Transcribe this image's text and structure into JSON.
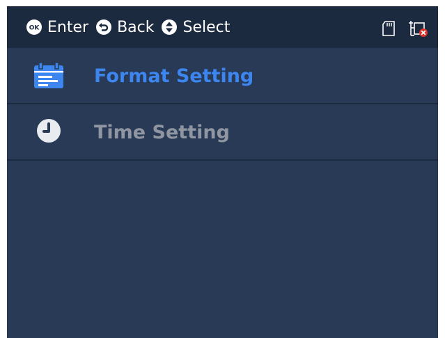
{
  "topbar": {
    "hints": [
      {
        "icon": "ok-button-icon",
        "label": "Enter"
      },
      {
        "icon": "back-button-icon",
        "label": "Back"
      },
      {
        "icon": "up-down-select-icon",
        "label": "Select"
      }
    ],
    "status_icons": [
      "sd-card-icon",
      "network-disconnected-icon"
    ]
  },
  "menu": {
    "items": [
      {
        "label": "Format Setting",
        "icon": "calendar-icon",
        "selected": true
      },
      {
        "label": "Time Setting",
        "icon": "clock-icon",
        "selected": false
      }
    ]
  },
  "colors": {
    "background": "#283a55",
    "topbar": "#1c2a3f",
    "selected_text": "#3d86f0",
    "unselected_text": "#8f96a1"
  }
}
